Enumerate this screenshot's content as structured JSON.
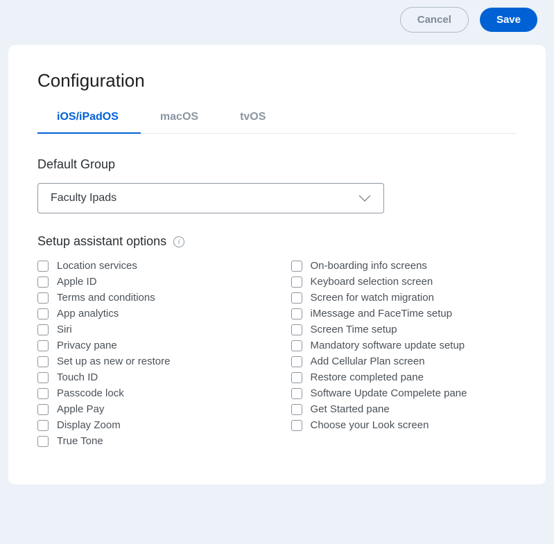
{
  "actions": {
    "cancel": "Cancel",
    "save": "Save"
  },
  "page_title": "Configuration",
  "tabs": [
    {
      "label": "iOS/iPadOS",
      "active": true
    },
    {
      "label": "macOS",
      "active": false
    },
    {
      "label": "tvOS",
      "active": false
    }
  ],
  "default_group": {
    "label": "Default Group",
    "selected": "Faculty Ipads"
  },
  "setup_assistant": {
    "label": "Setup assistant options",
    "options_left": [
      "Location services",
      "Apple ID",
      "Terms and conditions",
      "App analytics",
      "Siri",
      "Privacy pane",
      "Set up as new or restore",
      "Touch ID",
      "Passcode lock",
      "Apple Pay",
      "Display Zoom",
      "True Tone"
    ],
    "options_right": [
      "On-boarding info screens",
      "Keyboard selection screen",
      "Screen for watch migration",
      "iMessage and FaceTime setup",
      "Screen Time setup",
      "Mandatory software update setup",
      "Add Cellular Plan screen",
      "Restore completed pane",
      "Software Update Compelete pane",
      "Get Started pane",
      "Choose your Look screen"
    ]
  }
}
